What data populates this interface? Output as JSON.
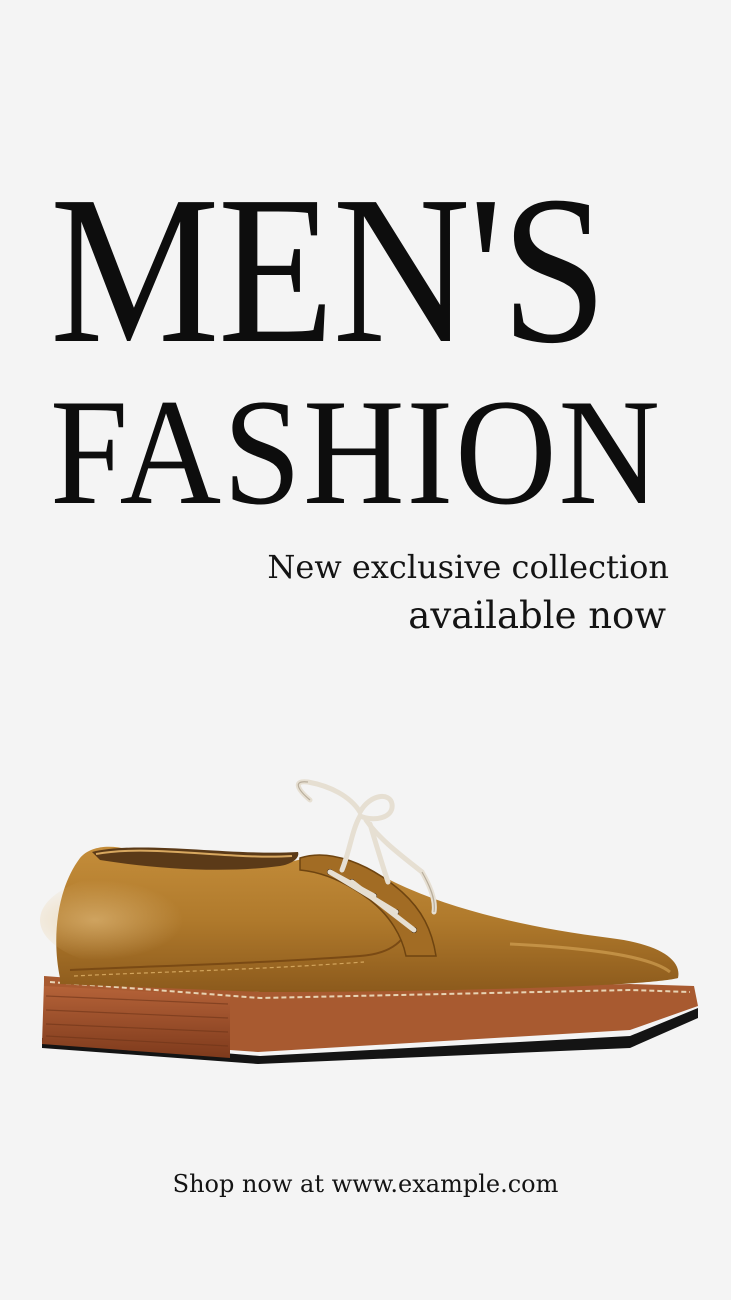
{
  "headline": {
    "line1": "MEN'S",
    "line2": "FASHION"
  },
  "tagline": {
    "line1": "New exclusive collection",
    "line2": "available now"
  },
  "product_image": {
    "description_icon": "leather-derby-shoe",
    "colors": {
      "leather": "#b07a2c",
      "sole": "#9a4a24",
      "lace": "#e6dfd2"
    }
  },
  "cta": {
    "text": "Shop now at www.example.com"
  },
  "colors": {
    "background": "#f4f4f4",
    "text": "#111111"
  }
}
